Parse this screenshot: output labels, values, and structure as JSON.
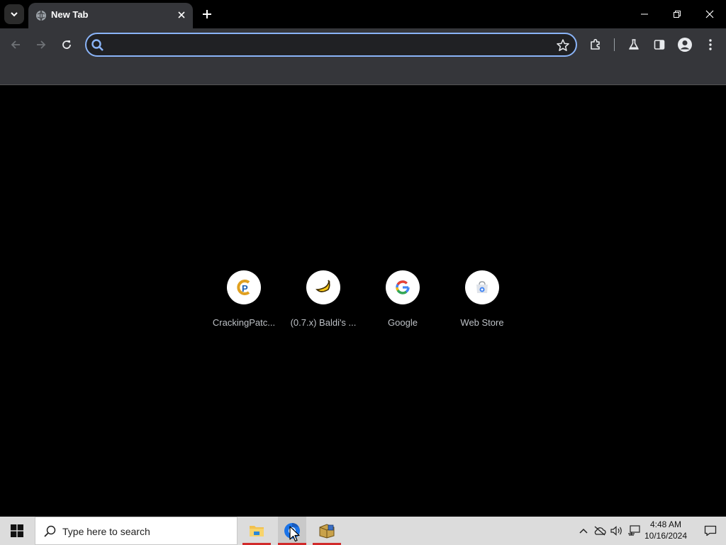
{
  "browser": {
    "tab": {
      "title": "New Tab"
    },
    "omnibox": {
      "value": "",
      "placeholder": ""
    }
  },
  "shortcuts": [
    {
      "label": "CrackingPatc...",
      "icon": "crackingpatching-icon"
    },
    {
      "label": "(0.7.x) Baldi's ...",
      "icon": "banana-icon"
    },
    {
      "label": "Google",
      "icon": "google-icon"
    },
    {
      "label": "Web Store",
      "icon": "web-store-icon"
    }
  ],
  "taskbar": {
    "search_placeholder": "Type here to search",
    "time": "4:48 AM",
    "date": "10/16/2024"
  },
  "colors": {
    "accent": "#8ab4f8",
    "toolbar": "#35363a",
    "taskbar": "#dcdcdc",
    "running_indicator": "#d12a2a"
  }
}
